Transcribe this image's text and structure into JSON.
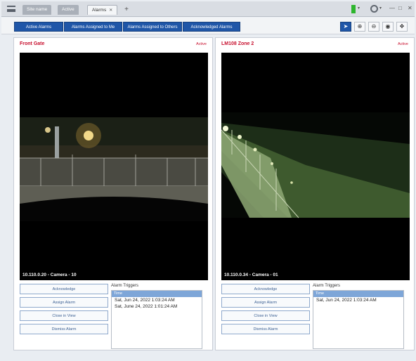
{
  "header": {
    "tabs": [
      {
        "label": "Site name"
      },
      {
        "label": "Active"
      },
      {
        "label": "Alarms"
      }
    ],
    "window_buttons": [
      "—",
      "□",
      "✕"
    ]
  },
  "filters": [
    "Active Alarms",
    "Alarms Assigned to Me",
    "Alarms Assigned to Others",
    "Acknowledged Alarms"
  ],
  "tools": [
    {
      "name": "pointer-tool",
      "glyph": "➤"
    },
    {
      "name": "zoom-in-tool",
      "glyph": "⊕"
    },
    {
      "name": "zoom-out-tool",
      "glyph": "⊖"
    },
    {
      "name": "pan-tool",
      "glyph": "◉"
    },
    {
      "name": "move-tool",
      "glyph": "✥"
    }
  ],
  "panels": [
    {
      "title": "Front Gate",
      "status": "Active",
      "camera_caption": "10.110.0.20 - Camera - 10",
      "actions": [
        "Acknowledge",
        "Assign Alarm",
        "Close in View",
        "Dismiss Alarm"
      ],
      "triggers_label": "Alarm Triggers",
      "triggers_header": "Time",
      "triggers": [
        "Sat, Jun 24, 2022 1:03:24 AM",
        "Sat, June 24, 2022 1:01:24 AM"
      ]
    },
    {
      "title": "LM108 Zone 2",
      "status": "Active",
      "camera_caption": "10.110.0.34 - Camera - 01",
      "actions": [
        "Acknowledge",
        "Assign Alarm",
        "Close in View",
        "Dismiss Alarm"
      ],
      "triggers_label": "Alarm Triggers",
      "triggers_header": "Time",
      "triggers": [
        "Sat, Jun 24, 2022 1:03:24 AM"
      ]
    }
  ],
  "colors": {
    "brand_blue": "#1f56a8",
    "alert_red": "#c8102e",
    "status_green": "#2db52d"
  }
}
